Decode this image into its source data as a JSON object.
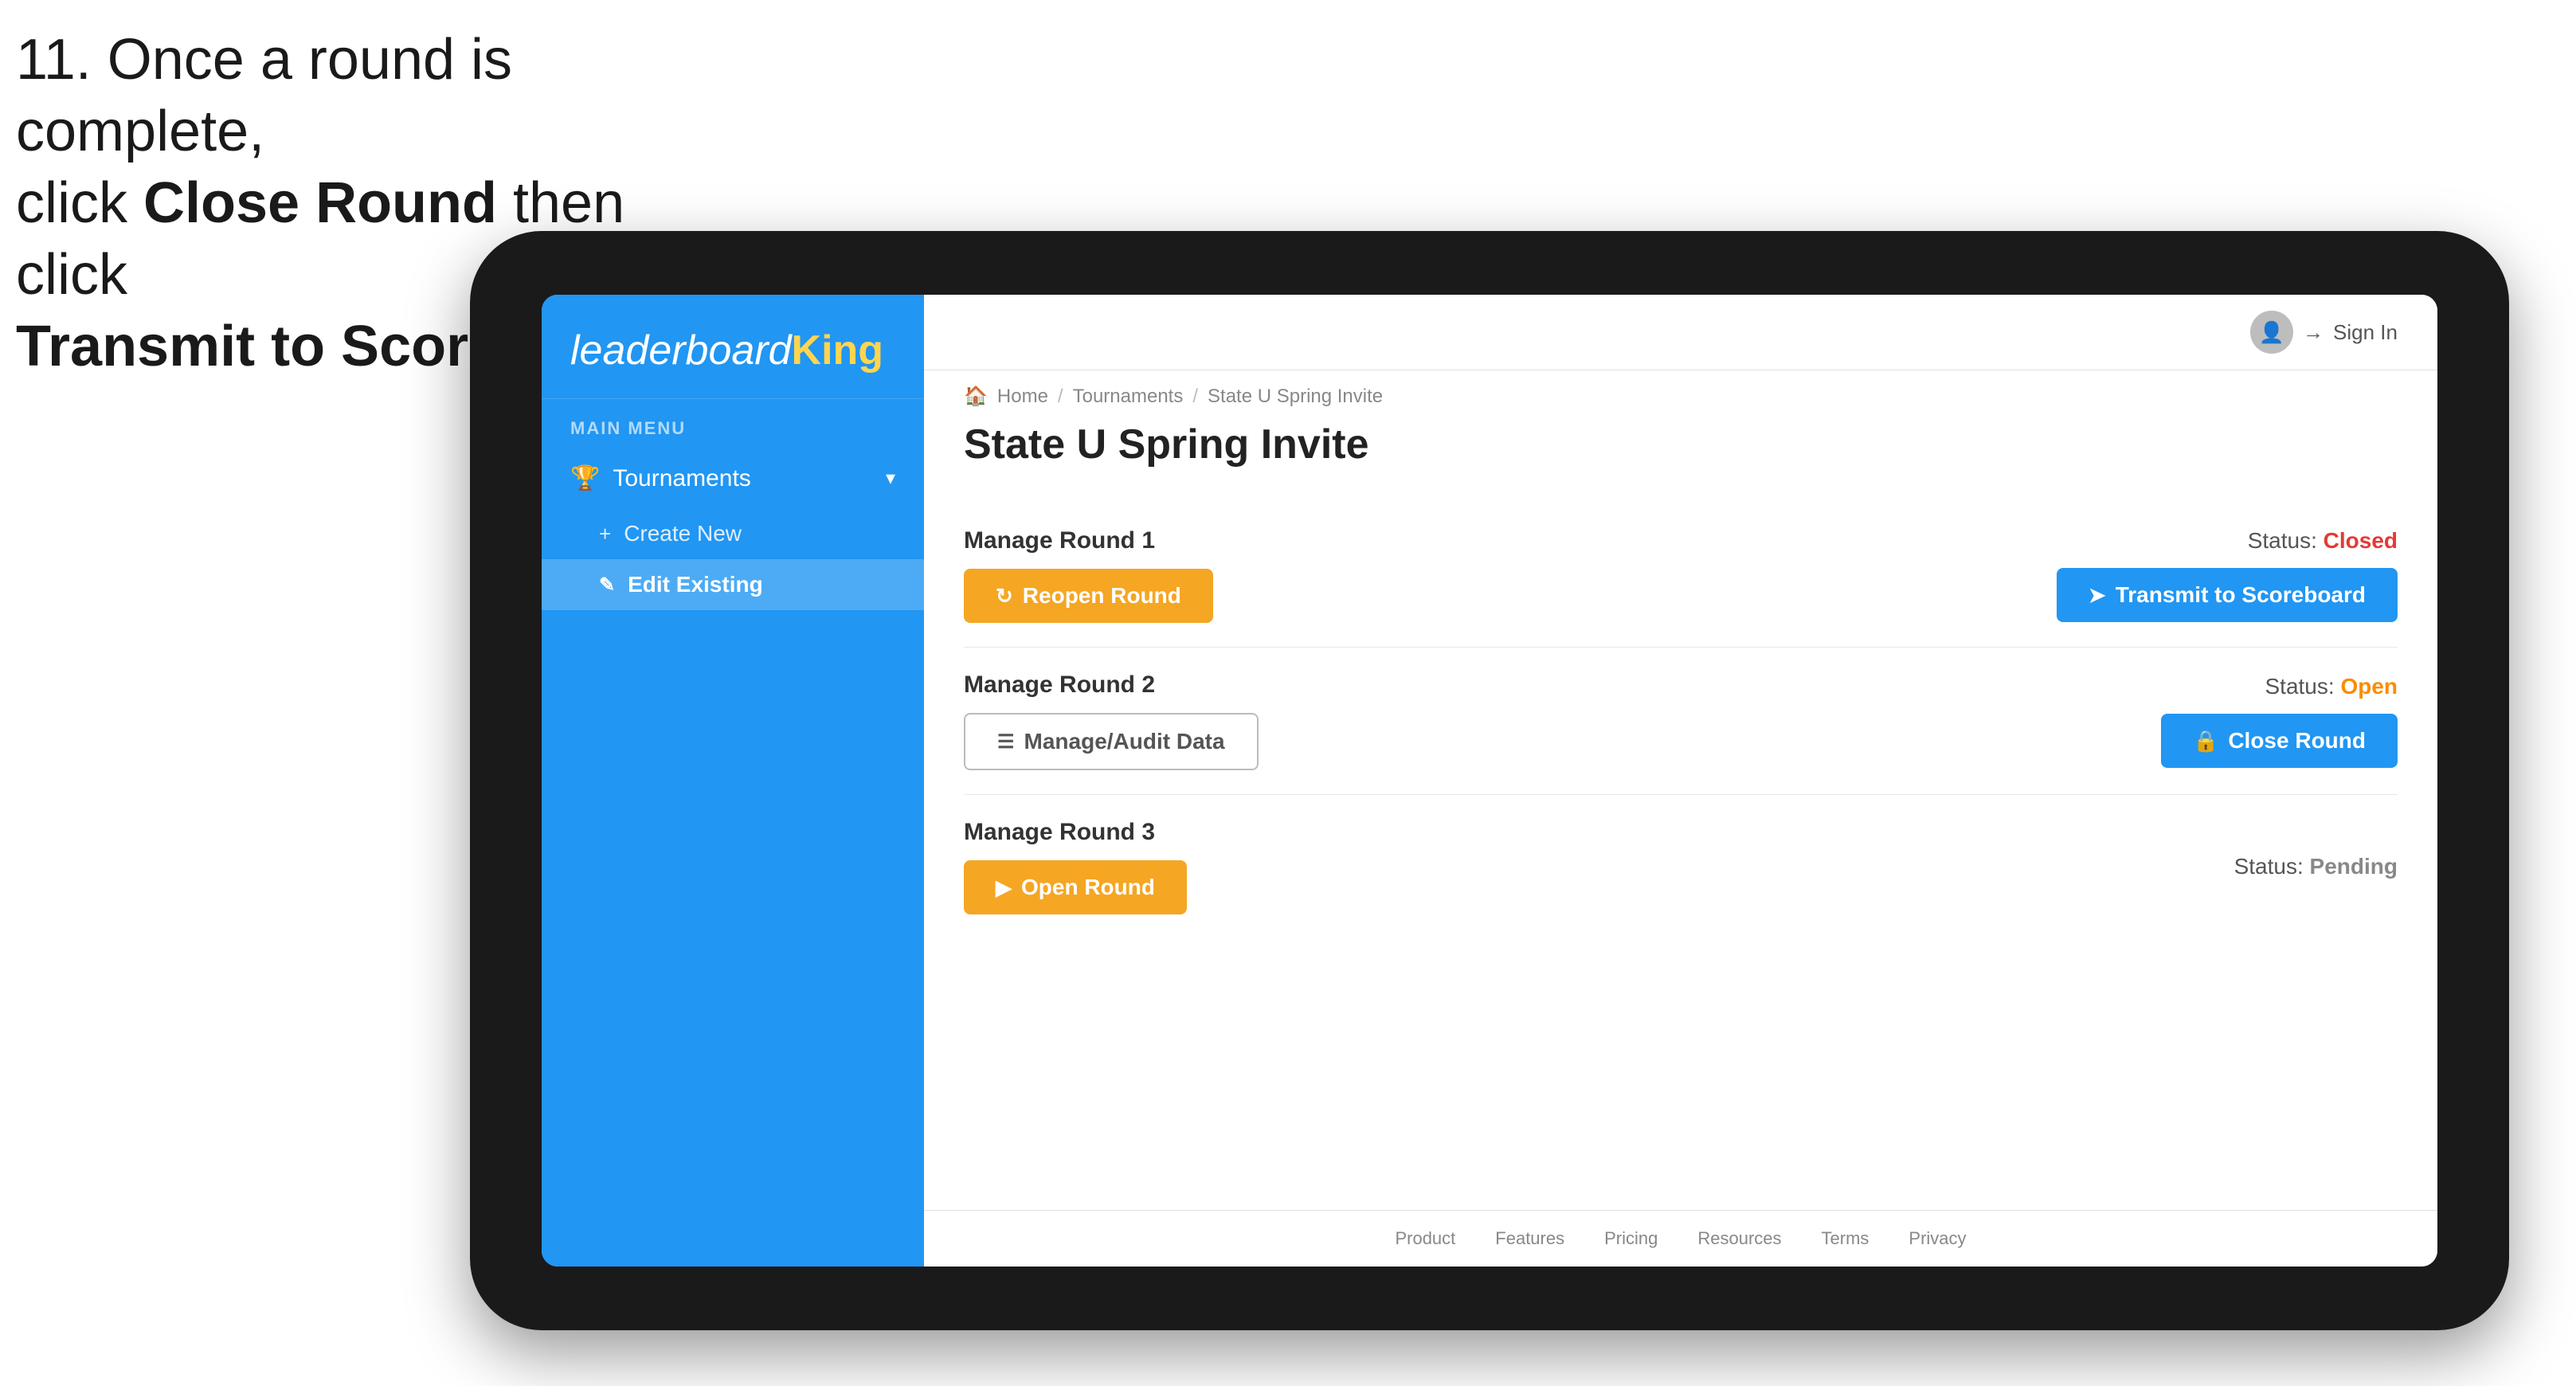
{
  "instruction": {
    "line1": "11. Once a round is complete,",
    "line2": "click ",
    "bold1": "Close Round",
    "line3": " then click",
    "bold2": "Transmit to Scoreboard."
  },
  "sidebar": {
    "logo": "leaderboard",
    "logo_king": "King",
    "menu_label": "MAIN MENU",
    "items": [
      {
        "label": "Tournaments",
        "icon": "trophy",
        "expanded": true
      }
    ],
    "sub_items": [
      {
        "label": "Create New",
        "icon": "+",
        "active": false
      },
      {
        "label": "Edit Existing",
        "icon": "edit",
        "active": true
      }
    ]
  },
  "topbar": {
    "sign_in": "Sign In"
  },
  "breadcrumb": {
    "home": "Home",
    "sep1": "/",
    "tournaments": "Tournaments",
    "sep2": "/",
    "current": "State U Spring Invite"
  },
  "page_title": "State U Spring Invite",
  "rounds": [
    {
      "id": "round1",
      "title": "Manage Round 1",
      "status_label": "Status:",
      "status_value": "Closed",
      "status_class": "status-closed",
      "buttons": [
        {
          "label": "Reopen Round",
          "style": "gold",
          "icon": "↻"
        },
        {
          "label": "Transmit to Scoreboard",
          "style": "blue",
          "icon": "➤"
        }
      ]
    },
    {
      "id": "round2",
      "title": "Manage Round 2",
      "status_label": "Status:",
      "status_value": "Open",
      "status_class": "status-open",
      "buttons": [
        {
          "label": "Manage/Audit Data",
          "style": "outline",
          "icon": "☰"
        },
        {
          "label": "Close Round",
          "style": "blue",
          "icon": "🔒"
        }
      ]
    },
    {
      "id": "round3",
      "title": "Manage Round 3",
      "status_label": "Status:",
      "status_value": "Pending",
      "status_class": "status-pending",
      "buttons": [
        {
          "label": "Open Round",
          "style": "gold",
          "icon": "▶"
        }
      ]
    }
  ],
  "footer": {
    "links": [
      "Product",
      "Features",
      "Pricing",
      "Resources",
      "Terms",
      "Privacy"
    ]
  }
}
